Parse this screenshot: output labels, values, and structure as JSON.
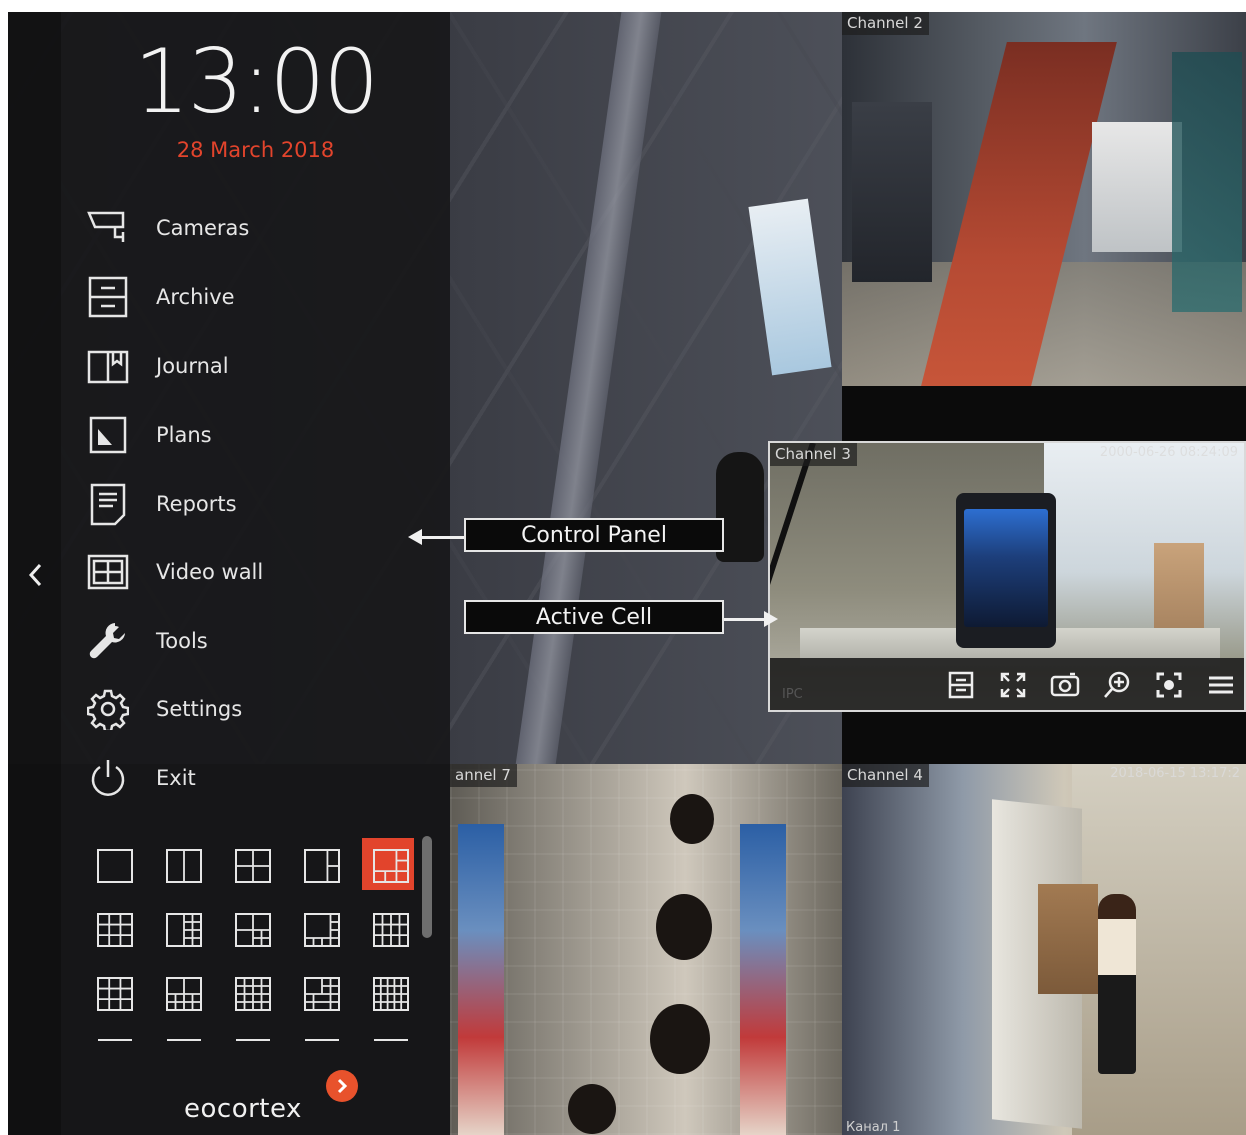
{
  "clock": {
    "time": "13:00",
    "date": "28 March 2018"
  },
  "menu": [
    {
      "id": "cameras",
      "label": "Cameras",
      "icon": "camera-icon"
    },
    {
      "id": "archive",
      "label": "Archive",
      "icon": "archive-icon"
    },
    {
      "id": "journal",
      "label": "Journal",
      "icon": "journal-icon"
    },
    {
      "id": "plans",
      "label": "Plans",
      "icon": "plans-icon"
    },
    {
      "id": "reports",
      "label": "Reports",
      "icon": "reports-icon"
    },
    {
      "id": "video-wall",
      "label": "Video wall",
      "icon": "video-wall-icon"
    },
    {
      "id": "tools",
      "label": "Tools",
      "icon": "wrench-icon"
    },
    {
      "id": "settings",
      "label": "Settings",
      "icon": "gear-icon"
    },
    {
      "id": "exit",
      "label": "Exit",
      "icon": "power-icon"
    }
  ],
  "layouts": {
    "selected_index": 4,
    "items": [
      "1x1",
      "1+1 vertical",
      "2x2",
      "1+2",
      "1+5",
      "3x3",
      "1+8 column",
      "2x2+3",
      "1+7",
      "4x4",
      "4x4 grid",
      "2x2+4",
      "4x4 dense",
      "1+12",
      "5x5"
    ]
  },
  "channels": {
    "main": {
      "label": ""
    },
    "ch2": {
      "label": "Channel 2"
    },
    "ch3": {
      "label": "Channel 3",
      "stamp": "2000-06-26 08:24:09",
      "corner": "IPC"
    },
    "ch7": {
      "label": "annel 7"
    },
    "ch4": {
      "label": "Channel 4",
      "stamp": "2018-06-15 13:17:2",
      "footer": "Канал 1"
    }
  },
  "active_cell_toolbar": [
    "archive-icon",
    "fullscreen-icon",
    "snapshot-icon",
    "zoom-in-icon",
    "focus-icon",
    "menu-icon"
  ],
  "annotations": {
    "control_panel": "Control Panel",
    "active_cell": "Active Cell"
  },
  "brand": {
    "name": "eocortex",
    "accent": "#e8522c"
  },
  "colors": {
    "accent": "#e2442c",
    "panel_bg": "#18181a",
    "text": "#e6e6e6"
  }
}
